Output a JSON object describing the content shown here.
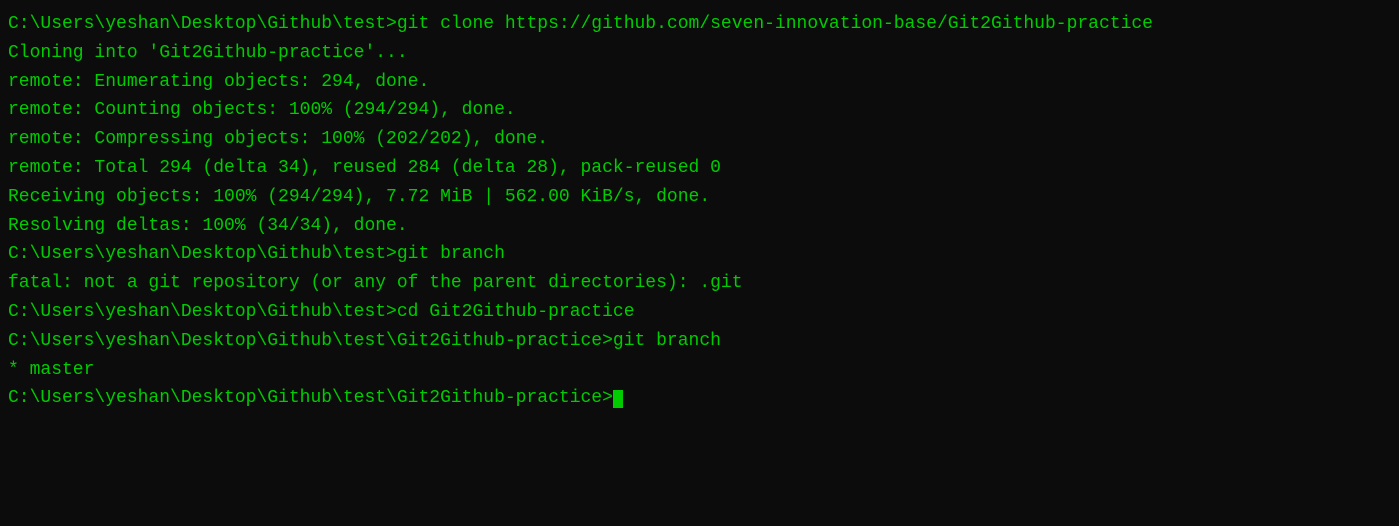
{
  "terminal": {
    "lines": [
      "C:\\Users\\yeshan\\Desktop\\Github\\test>git clone https://github.com/seven-innovation-base/Git2Github-practice",
      "Cloning into 'Git2Github-practice'...",
      "remote: Enumerating objects: 294, done.",
      "remote: Counting objects: 100% (294/294), done.",
      "remote: Compressing objects: 100% (202/202), done.",
      "remote: Total 294 (delta 34), reused 284 (delta 28), pack-reused 0",
      "Receiving objects: 100% (294/294), 7.72 MiB | 562.00 KiB/s, done.",
      "Resolving deltas: 100% (34/34), done.",
      "",
      "C:\\Users\\yeshan\\Desktop\\Github\\test>git branch",
      "fatal: not a git repository (or any of the parent directories): .git",
      "",
      "C:\\Users\\yeshan\\Desktop\\Github\\test>cd Git2Github-practice",
      "",
      "C:\\Users\\yeshan\\Desktop\\Github\\test\\Git2Github-practice>git branch",
      "* master",
      "",
      "C:\\Users\\yeshan\\Desktop\\Github\\test\\Git2Github-practice>"
    ],
    "has_cursor": true
  }
}
